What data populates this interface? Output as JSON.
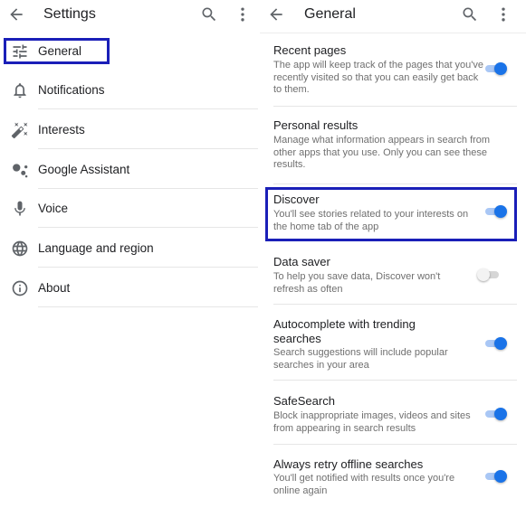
{
  "left": {
    "title": "Settings",
    "items": [
      {
        "label": "General",
        "icon": "tune-icon"
      },
      {
        "label": "Notifications",
        "icon": "bell-icon"
      },
      {
        "label": "Interests",
        "icon": "magic-wand-icon"
      },
      {
        "label": "Google Assistant",
        "icon": "assistant-icon"
      },
      {
        "label": "Voice",
        "icon": "microphone-icon"
      },
      {
        "label": "Language and region",
        "icon": "globe-icon"
      },
      {
        "label": "About",
        "icon": "info-icon"
      }
    ],
    "highlighted": "General"
  },
  "right": {
    "title": "General",
    "items": [
      {
        "title": "Recent pages",
        "subtitle": "The app will keep track of the pages that you've recently visited so that you can easily get back to them.",
        "toggle": true
      },
      {
        "title": "Personal results",
        "subtitle": "Manage what information appears in search from other apps that you use. Only you can see these results."
      },
      {
        "title": "Discover",
        "subtitle": "You'll see stories related to your interests on the home tab of the app",
        "toggle": true
      },
      {
        "title": "Data saver",
        "subtitle": "To help you save data, Discover won't refresh as often",
        "toggle": false
      },
      {
        "title": "Autocomplete with trending searches",
        "subtitle": "Search suggestions will include popular searches in your area",
        "toggle": true
      },
      {
        "title": "SafeSearch",
        "subtitle": "Block inappropriate images, videos and sites from appearing in search results",
        "toggle": true
      },
      {
        "title": "Always retry offline searches",
        "subtitle": "You'll get notified with results once you're online again",
        "toggle": true
      }
    ],
    "highlighted": "Discover"
  },
  "colors": {
    "accent": "#1a73e8",
    "highlight_border": "#1a1fb8",
    "icon_gray": "#5f6368"
  }
}
